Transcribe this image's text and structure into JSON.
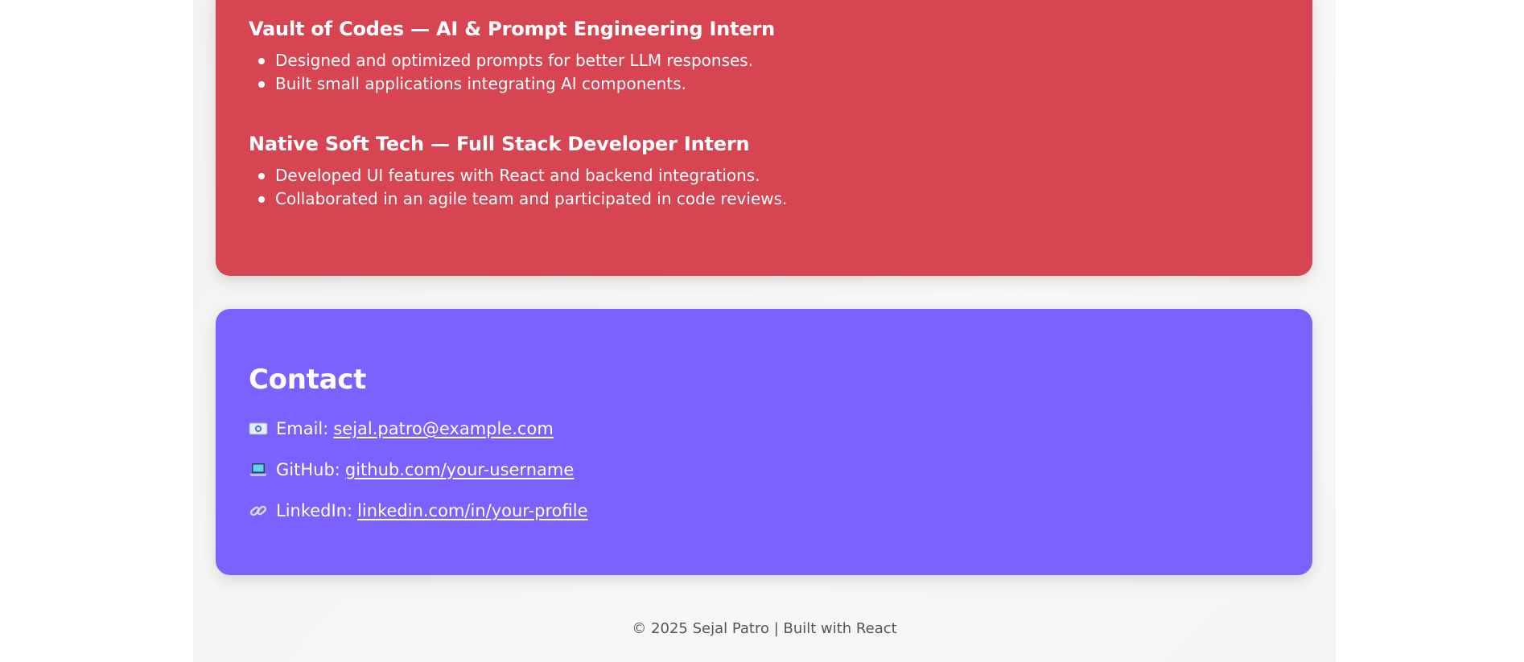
{
  "experience": {
    "jobs": [
      {
        "title": "Vault of Codes — AI & Prompt Engineering Intern",
        "bullets": [
          "Designed and optimized prompts for better LLM responses.",
          "Built small applications integrating AI components."
        ]
      },
      {
        "title": "Native Soft Tech — Full Stack Developer Intern",
        "bullets": [
          "Developed UI features with React and backend integrations.",
          "Collaborated in an agile team and participated in code reviews."
        ]
      }
    ]
  },
  "contact": {
    "title": "Contact",
    "items": [
      {
        "icon": "email-icon",
        "label": "Email:",
        "link_text": "sejal.patro@example.com"
      },
      {
        "icon": "laptop-icon",
        "label": "GitHub:",
        "link_text": "github.com/your-username"
      },
      {
        "icon": "link-icon",
        "label": "LinkedIn:",
        "link_text": "linkedin.com/in/your-profile"
      }
    ]
  },
  "footer": {
    "text": "© 2025 Sejal Patro | Built with React"
  },
  "colors": {
    "experience_card": "#d84552",
    "contact_card": "#7b62fe",
    "page_background": "#f5f4f3"
  }
}
